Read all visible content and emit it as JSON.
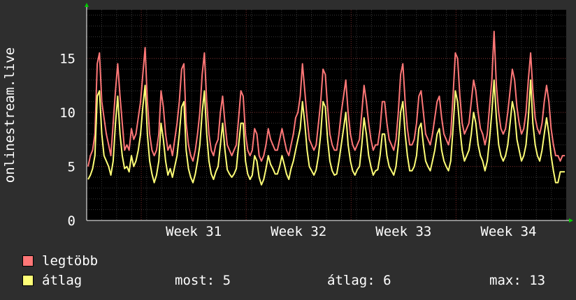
{
  "chart_data": {
    "type": "line",
    "ylabel": "onlinestream.live",
    "ylim": [
      0,
      19.5
    ],
    "yticks": [
      0,
      5,
      10,
      15
    ],
    "xlim_weeks": [
      30.48,
      35.05
    ],
    "week_ticks": [
      {
        "label": "Week 31",
        "week": 31
      },
      {
        "label": "Week 32",
        "week": 32
      },
      {
        "label": "Week 33",
        "week": 33
      },
      {
        "label": "Week 34",
        "week": 34
      }
    ],
    "grid": true,
    "legend": "bottom",
    "series": [
      {
        "name": "legtöbb",
        "color": "#ff7777",
        "values": [
          5,
          6,
          6.5,
          8,
          14.5,
          15.5,
          11,
          9.5,
          8,
          7,
          6,
          9,
          12,
          14.5,
          11.5,
          9,
          6.5,
          7,
          6.5,
          8.5,
          7.5,
          8,
          9.5,
          11,
          13.5,
          16,
          11,
          8,
          6.5,
          6,
          6.5,
          8,
          12,
          10.5,
          8,
          6.5,
          7,
          6,
          7.5,
          9,
          11,
          14,
          14.5,
          9,
          7,
          6,
          5.5,
          6.5,
          8,
          10,
          13.5,
          15.5,
          11,
          8,
          6.5,
          6,
          7,
          7.5,
          10,
          11.5,
          9,
          7,
          6.5,
          6,
          6.5,
          7,
          9.5,
          12,
          11.5,
          8,
          6.5,
          6,
          6.5,
          8.5,
          8,
          6,
          5.5,
          6,
          7,
          8.5,
          7.5,
          7,
          6.5,
          6.5,
          7.5,
          8.5,
          7.5,
          6.5,
          6,
          7,
          8,
          9.5,
          10,
          11.5,
          14.5,
          12,
          9.5,
          7.5,
          7,
          6.5,
          7,
          9,
          11,
          14,
          13.5,
          10.5,
          8,
          7,
          6.5,
          6.5,
          8,
          10,
          11.5,
          13,
          10,
          8,
          7,
          6.5,
          7,
          7.5,
          10,
          12.5,
          11,
          9,
          7.5,
          6.5,
          7,
          7,
          8.5,
          11,
          11,
          9,
          7.5,
          7,
          6.5,
          7.5,
          10,
          13.5,
          14.5,
          11,
          8.5,
          7,
          7,
          7.5,
          9,
          11.5,
          12,
          10,
          8,
          7.5,
          7,
          8,
          9.5,
          11,
          11.5,
          9.5,
          8,
          7.5,
          7,
          8,
          11.5,
          15.5,
          15,
          11.5,
          9,
          8,
          8.5,
          9,
          11,
          13,
          12,
          10,
          8.5,
          8,
          7,
          8,
          10.5,
          13,
          17.5,
          12.5,
          10,
          8.5,
          8,
          8.5,
          10,
          12,
          14,
          13,
          10.5,
          9,
          8,
          8.5,
          10,
          13,
          15.5,
          12,
          9.5,
          8.5,
          8,
          9,
          11,
          12.5,
          11,
          8.5,
          7,
          6,
          6,
          5.5,
          6,
          6
        ]
      },
      {
        "name": "átlag",
        "color": "#ffff77",
        "values": [
          3.8,
          4.2,
          4.8,
          6,
          11.5,
          12,
          8,
          6,
          5.5,
          5,
          4.2,
          5.5,
          9,
          11.5,
          8,
          6,
          4.8,
          5,
          4.5,
          6,
          5,
          5.5,
          6.5,
          8,
          10.5,
          12.5,
          8,
          5.5,
          4.3,
          3.5,
          4.2,
          5.5,
          9,
          7.5,
          5.5,
          4.2,
          4.8,
          4,
          5,
          6,
          8,
          10.5,
          11,
          6.5,
          4.8,
          4,
          3.5,
          4.3,
          5.5,
          7,
          10,
          12,
          8,
          5.5,
          4.3,
          3.8,
          4.5,
          5,
          7,
          9,
          6.5,
          4.7,
          4.3,
          4,
          4.3,
          4.8,
          7,
          9,
          9,
          5.5,
          4.3,
          3.8,
          4.2,
          6,
          5.5,
          4,
          3.3,
          3.8,
          4.8,
          6,
          5.2,
          4.8,
          4.3,
          4.3,
          5,
          6,
          5.2,
          4.3,
          3.8,
          4.8,
          5.5,
          6.5,
          7.5,
          8.5,
          11,
          9,
          6.5,
          5,
          4.6,
          4.2,
          4.7,
          6,
          8,
          11,
          10.5,
          7.5,
          5.5,
          4.6,
          4.2,
          4.3,
          5.5,
          7,
          8.5,
          10,
          7,
          5.5,
          4.6,
          4.2,
          4.7,
          5,
          7,
          9.5,
          8,
          6,
          5,
          4.2,
          4.6,
          4.7,
          6,
          8,
          8,
          6,
          5,
          4.6,
          4.2,
          5,
          7,
          10,
          11,
          8,
          6,
          4.6,
          4.6,
          5,
          6,
          8.5,
          9,
          7,
          5.5,
          5,
          4.6,
          5.5,
          6.5,
          8,
          8.5,
          6.5,
          5.5,
          5,
          4.6,
          5.5,
          8.5,
          12,
          11,
          8.5,
          6.5,
          5.5,
          6,
          6.5,
          8,
          10,
          9,
          7,
          6,
          5.5,
          4.6,
          5.5,
          7.5,
          10,
          13,
          9.5,
          7,
          6,
          5.5,
          6,
          7,
          9,
          11,
          10,
          7.5,
          6.5,
          5.5,
          6,
          7,
          9.5,
          13,
          9,
          7,
          6,
          5.5,
          6.5,
          8,
          9.5,
          8,
          6,
          4.6,
          3.5,
          3.5,
          4.5,
          4.5,
          4.5
        ]
      }
    ]
  },
  "legend": {
    "items": [
      {
        "label": "legtöbb",
        "color": "#ff7777"
      },
      {
        "label": "átlag",
        "color": "#ffff77"
      }
    ],
    "stats": {
      "now": "most: 5",
      "avg": "átlag: 6",
      "max": "max: 13"
    }
  }
}
